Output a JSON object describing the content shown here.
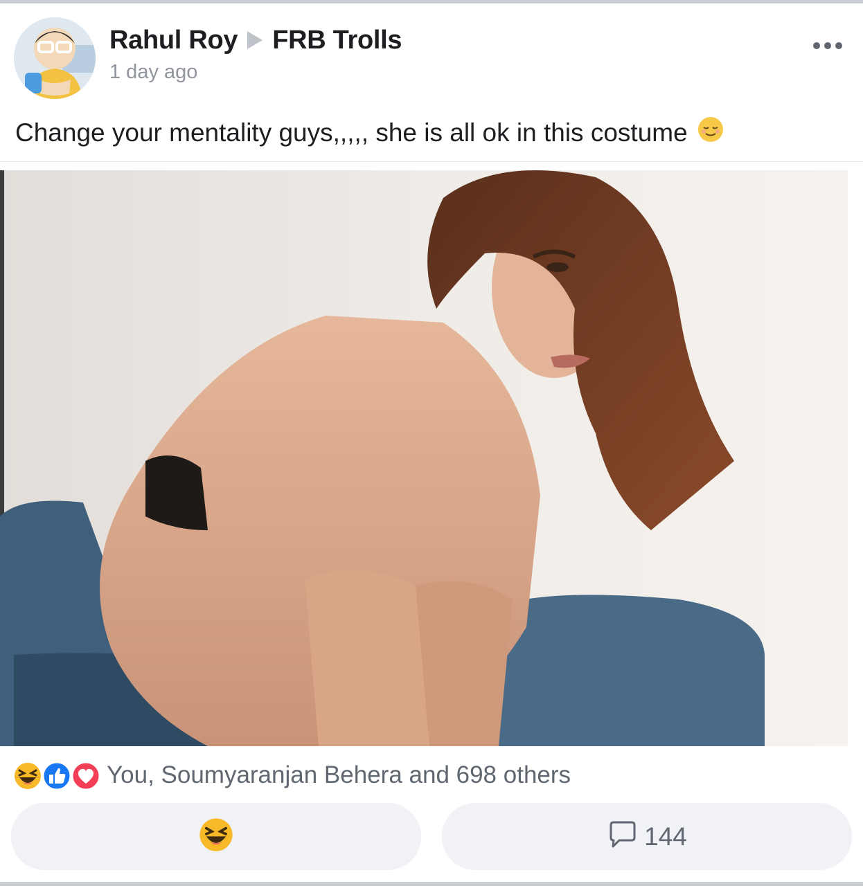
{
  "post": {
    "author": "Rahul Roy",
    "group": "FRB Trolls",
    "timestamp": "1 day ago",
    "text": "Change your mentality guys,,,,, she is all ok in this costume"
  },
  "reactions": {
    "summary": "You, Soumyaranjan Behera and 698 others",
    "icons": [
      "haha-icon",
      "like-icon",
      "love-icon"
    ]
  },
  "actions": {
    "comment_count": "144"
  },
  "colors": {
    "secondary_text": "#606770",
    "button_bg": "#f0f2f5",
    "like_blue": "#1877f2",
    "love_red": "#f33e58",
    "haha_yellow": "#f7b928"
  }
}
